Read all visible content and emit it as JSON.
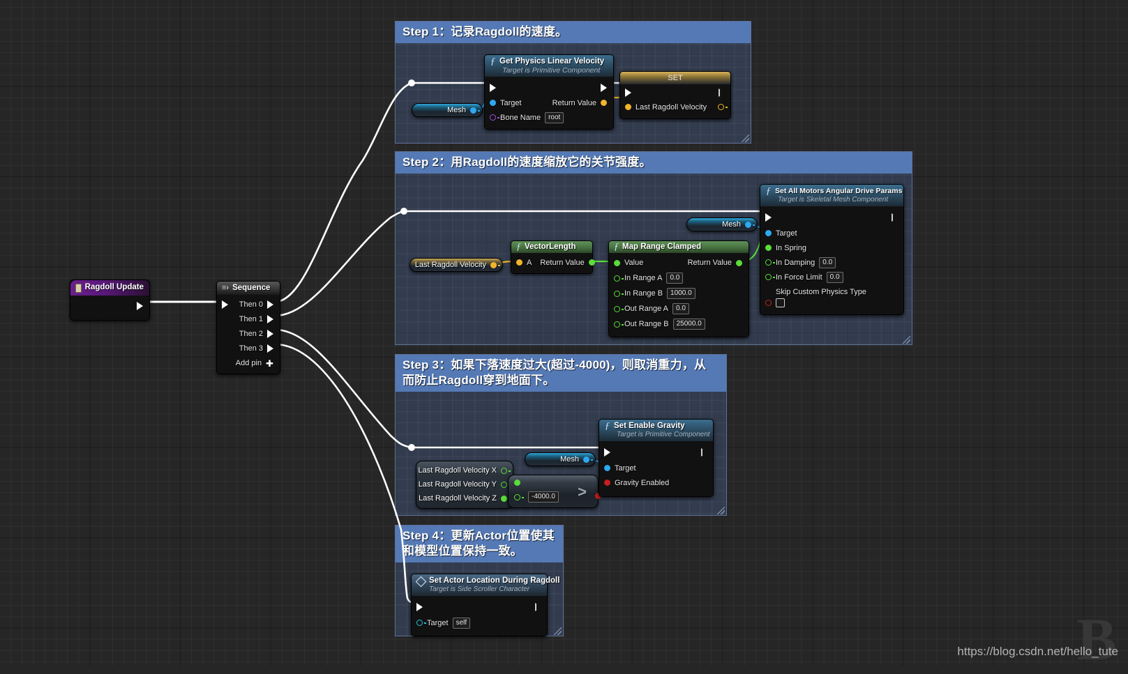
{
  "watermark": {
    "url": "https://blog.csdn.net/hello_tute",
    "logo": "B"
  },
  "comments": [
    {
      "id": "step1",
      "title": "Step 1：记录Ragdoll的速度。"
    },
    {
      "id": "step2",
      "title": "Step 2：用Ragdoll的速度缩放它的关节强度。"
    },
    {
      "id": "step3",
      "title": "Step 3：如果下落速度过大(超过-4000)，则取消重力，从\n而防止Ragdoll穿到地面下。"
    },
    {
      "id": "step4",
      "title": "Step 4：更新Actor位置使其\n和模型位置保持一致。"
    }
  ],
  "nodes": {
    "event": {
      "title": "Ragdoll Update"
    },
    "sequence": {
      "title": "Sequence",
      "outputs": [
        "Then 0",
        "Then 1",
        "Then 2",
        "Then 3"
      ],
      "add_pin": "Add pin"
    },
    "get_physics_linear_velocity": {
      "title": "Get Physics Linear Velocity",
      "subtitle": "Target is Primitive Component",
      "in_target": "Target",
      "in_bone_name": "Bone Name",
      "bone_name_value": "root",
      "out_return": "Return Value"
    },
    "set_last_ragdoll_velocity": {
      "title": "SET",
      "pin_label": "Last Ragdoll Velocity"
    },
    "mesh_1": {
      "label": "Mesh"
    },
    "mesh_2": {
      "label": "Mesh"
    },
    "mesh_3": {
      "label": "Mesh"
    },
    "last_ragdoll_velocity_get": {
      "label": "Last Ragdoll Velocity"
    },
    "vector_length": {
      "title": "VectorLength",
      "in_a": "A",
      "out_return": "Return Value"
    },
    "map_range_clamped": {
      "title": "Map Range Clamped",
      "in_value": "Value",
      "out_return": "Return Value",
      "params": [
        {
          "label": "In Range A",
          "value": "0.0"
        },
        {
          "label": "In Range B",
          "value": "1000.0"
        },
        {
          "label": "Out Range A",
          "value": "0.0"
        },
        {
          "label": "Out Range B",
          "value": "25000.0"
        }
      ]
    },
    "set_all_motors": {
      "title": "Set All Motors Angular Drive Params",
      "subtitle": "Target is Skeletal Mesh Component",
      "in_target": "Target",
      "in_spring": "In Spring",
      "in_damping": "In Damping",
      "in_damping_value": "0.0",
      "in_force_limit": "In Force Limit",
      "in_force_limit_value": "0.0",
      "skip_custom": "Skip Custom Physics Type"
    },
    "velocity_split": {
      "rows": [
        "Last Ragdoll Velocity X",
        "Last Ragdoll Velocity Y",
        "Last Ragdoll Velocity Z"
      ]
    },
    "compare_node": {
      "glyph": ">",
      "operand_value": "-4000.0"
    },
    "set_enable_gravity": {
      "title": "Set Enable Gravity",
      "subtitle": "Target is Primitive Component",
      "in_target": "Target",
      "in_gravity_enabled": "Gravity Enabled"
    },
    "set_actor_location": {
      "title": "Set Actor Location During Ragdoll",
      "subtitle": "Target is Side Scroller Character",
      "in_target": "Target",
      "target_value": "self"
    }
  },
  "colors": {
    "comment_header": "#5479b5",
    "comment_fill": "#3a4c6a",
    "exec_wire": "#ffffff",
    "pin_exec": "#ffffff",
    "pin_object": "#2ea9f0",
    "pin_vector": "#f0b52a",
    "pin_float": "#5bdc3a",
    "pin_name": "#a24fd6",
    "pin_bool": "#c51f1f",
    "graph_bg": "#262626"
  }
}
